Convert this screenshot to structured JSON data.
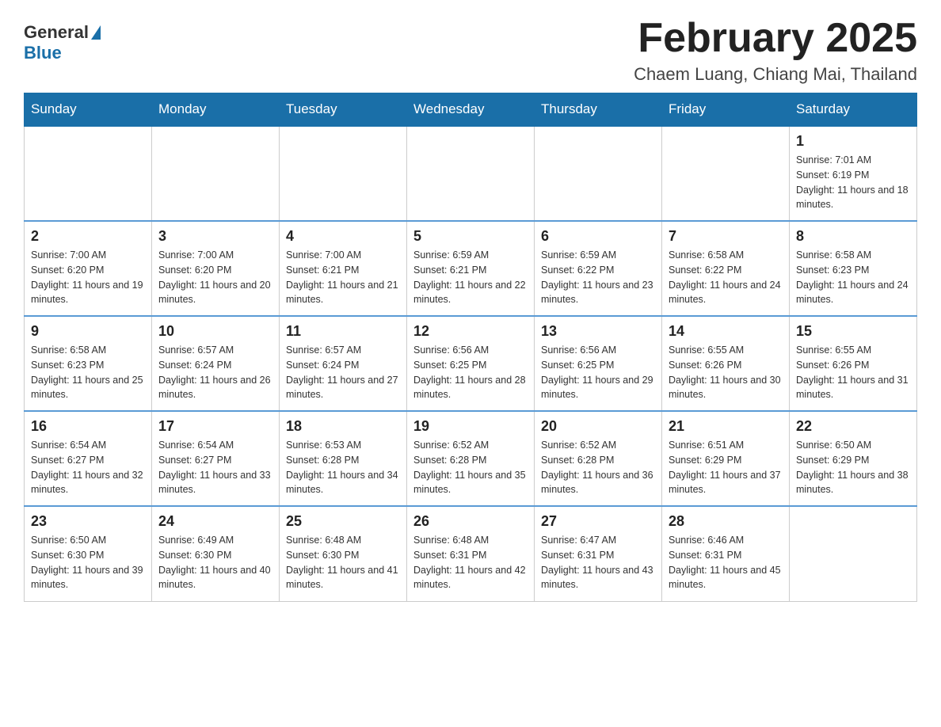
{
  "header": {
    "logo_general": "General",
    "logo_blue": "Blue",
    "month_title": "February 2025",
    "location": "Chaem Luang, Chiang Mai, Thailand"
  },
  "weekdays": [
    "Sunday",
    "Monday",
    "Tuesday",
    "Wednesday",
    "Thursday",
    "Friday",
    "Saturday"
  ],
  "weeks": [
    [
      {
        "day": "",
        "sunrise": "",
        "sunset": "",
        "daylight": ""
      },
      {
        "day": "",
        "sunrise": "",
        "sunset": "",
        "daylight": ""
      },
      {
        "day": "",
        "sunrise": "",
        "sunset": "",
        "daylight": ""
      },
      {
        "day": "",
        "sunrise": "",
        "sunset": "",
        "daylight": ""
      },
      {
        "day": "",
        "sunrise": "",
        "sunset": "",
        "daylight": ""
      },
      {
        "day": "",
        "sunrise": "",
        "sunset": "",
        "daylight": ""
      },
      {
        "day": "1",
        "sunrise": "Sunrise: 7:01 AM",
        "sunset": "Sunset: 6:19 PM",
        "daylight": "Daylight: 11 hours and 18 minutes."
      }
    ],
    [
      {
        "day": "2",
        "sunrise": "Sunrise: 7:00 AM",
        "sunset": "Sunset: 6:20 PM",
        "daylight": "Daylight: 11 hours and 19 minutes."
      },
      {
        "day": "3",
        "sunrise": "Sunrise: 7:00 AM",
        "sunset": "Sunset: 6:20 PM",
        "daylight": "Daylight: 11 hours and 20 minutes."
      },
      {
        "day": "4",
        "sunrise": "Sunrise: 7:00 AM",
        "sunset": "Sunset: 6:21 PM",
        "daylight": "Daylight: 11 hours and 21 minutes."
      },
      {
        "day": "5",
        "sunrise": "Sunrise: 6:59 AM",
        "sunset": "Sunset: 6:21 PM",
        "daylight": "Daylight: 11 hours and 22 minutes."
      },
      {
        "day": "6",
        "sunrise": "Sunrise: 6:59 AM",
        "sunset": "Sunset: 6:22 PM",
        "daylight": "Daylight: 11 hours and 23 minutes."
      },
      {
        "day": "7",
        "sunrise": "Sunrise: 6:58 AM",
        "sunset": "Sunset: 6:22 PM",
        "daylight": "Daylight: 11 hours and 24 minutes."
      },
      {
        "day": "8",
        "sunrise": "Sunrise: 6:58 AM",
        "sunset": "Sunset: 6:23 PM",
        "daylight": "Daylight: 11 hours and 24 minutes."
      }
    ],
    [
      {
        "day": "9",
        "sunrise": "Sunrise: 6:58 AM",
        "sunset": "Sunset: 6:23 PM",
        "daylight": "Daylight: 11 hours and 25 minutes."
      },
      {
        "day": "10",
        "sunrise": "Sunrise: 6:57 AM",
        "sunset": "Sunset: 6:24 PM",
        "daylight": "Daylight: 11 hours and 26 minutes."
      },
      {
        "day": "11",
        "sunrise": "Sunrise: 6:57 AM",
        "sunset": "Sunset: 6:24 PM",
        "daylight": "Daylight: 11 hours and 27 minutes."
      },
      {
        "day": "12",
        "sunrise": "Sunrise: 6:56 AM",
        "sunset": "Sunset: 6:25 PM",
        "daylight": "Daylight: 11 hours and 28 minutes."
      },
      {
        "day": "13",
        "sunrise": "Sunrise: 6:56 AM",
        "sunset": "Sunset: 6:25 PM",
        "daylight": "Daylight: 11 hours and 29 minutes."
      },
      {
        "day": "14",
        "sunrise": "Sunrise: 6:55 AM",
        "sunset": "Sunset: 6:26 PM",
        "daylight": "Daylight: 11 hours and 30 minutes."
      },
      {
        "day": "15",
        "sunrise": "Sunrise: 6:55 AM",
        "sunset": "Sunset: 6:26 PM",
        "daylight": "Daylight: 11 hours and 31 minutes."
      }
    ],
    [
      {
        "day": "16",
        "sunrise": "Sunrise: 6:54 AM",
        "sunset": "Sunset: 6:27 PM",
        "daylight": "Daylight: 11 hours and 32 minutes."
      },
      {
        "day": "17",
        "sunrise": "Sunrise: 6:54 AM",
        "sunset": "Sunset: 6:27 PM",
        "daylight": "Daylight: 11 hours and 33 minutes."
      },
      {
        "day": "18",
        "sunrise": "Sunrise: 6:53 AM",
        "sunset": "Sunset: 6:28 PM",
        "daylight": "Daylight: 11 hours and 34 minutes."
      },
      {
        "day": "19",
        "sunrise": "Sunrise: 6:52 AM",
        "sunset": "Sunset: 6:28 PM",
        "daylight": "Daylight: 11 hours and 35 minutes."
      },
      {
        "day": "20",
        "sunrise": "Sunrise: 6:52 AM",
        "sunset": "Sunset: 6:28 PM",
        "daylight": "Daylight: 11 hours and 36 minutes."
      },
      {
        "day": "21",
        "sunrise": "Sunrise: 6:51 AM",
        "sunset": "Sunset: 6:29 PM",
        "daylight": "Daylight: 11 hours and 37 minutes."
      },
      {
        "day": "22",
        "sunrise": "Sunrise: 6:50 AM",
        "sunset": "Sunset: 6:29 PM",
        "daylight": "Daylight: 11 hours and 38 minutes."
      }
    ],
    [
      {
        "day": "23",
        "sunrise": "Sunrise: 6:50 AM",
        "sunset": "Sunset: 6:30 PM",
        "daylight": "Daylight: 11 hours and 39 minutes."
      },
      {
        "day": "24",
        "sunrise": "Sunrise: 6:49 AM",
        "sunset": "Sunset: 6:30 PM",
        "daylight": "Daylight: 11 hours and 40 minutes."
      },
      {
        "day": "25",
        "sunrise": "Sunrise: 6:48 AM",
        "sunset": "Sunset: 6:30 PM",
        "daylight": "Daylight: 11 hours and 41 minutes."
      },
      {
        "day": "26",
        "sunrise": "Sunrise: 6:48 AM",
        "sunset": "Sunset: 6:31 PM",
        "daylight": "Daylight: 11 hours and 42 minutes."
      },
      {
        "day": "27",
        "sunrise": "Sunrise: 6:47 AM",
        "sunset": "Sunset: 6:31 PM",
        "daylight": "Daylight: 11 hours and 43 minutes."
      },
      {
        "day": "28",
        "sunrise": "Sunrise: 6:46 AM",
        "sunset": "Sunset: 6:31 PM",
        "daylight": "Daylight: 11 hours and 45 minutes."
      },
      {
        "day": "",
        "sunrise": "",
        "sunset": "",
        "daylight": ""
      }
    ]
  ]
}
